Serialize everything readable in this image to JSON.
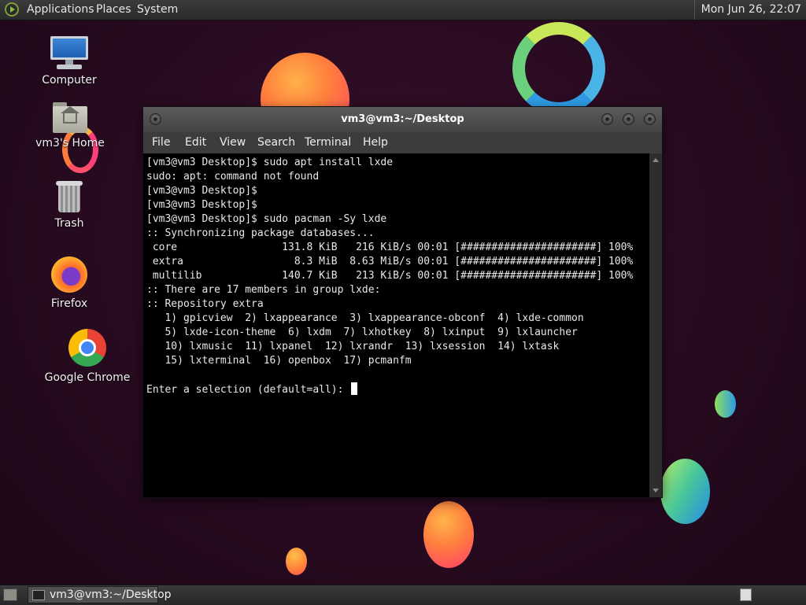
{
  "top_panel": {
    "menus": [
      "Applications",
      "Places",
      "System"
    ],
    "clock": "Mon Jun 26, 22:07"
  },
  "desktop": {
    "icons": [
      {
        "label": "Computer",
        "icon": "computer-icon"
      },
      {
        "label": "vm3's Home",
        "icon": "home-folder-icon"
      },
      {
        "label": "Trash",
        "icon": "trash-icon"
      },
      {
        "label": "Firefox",
        "icon": "firefox-icon"
      },
      {
        "label": "Google Chrome",
        "icon": "chrome-icon"
      }
    ]
  },
  "window": {
    "title": "vm3@vm3:~/Desktop",
    "menu": [
      "File",
      "Edit",
      "View",
      "Search",
      "Terminal",
      "Help"
    ],
    "terminal_lines": [
      "[vm3@vm3 Desktop]$ sudo apt install lxde",
      "sudo: apt: command not found",
      "[vm3@vm3 Desktop]$",
      "[vm3@vm3 Desktop]$",
      "[vm3@vm3 Desktop]$ sudo pacman -Sy lxde",
      ":: Synchronizing package databases...",
      " core                 131.8 KiB   216 KiB/s 00:01 [######################] 100%",
      " extra                  8.3 MiB  8.63 MiB/s 00:01 [######################] 100%",
      " multilib             140.7 KiB   213 KiB/s 00:01 [######################] 100%",
      ":: There are 17 members in group lxde:",
      ":: Repository extra",
      "   1) gpicview  2) lxappearance  3) lxappearance-obconf  4) lxde-common",
      "   5) lxde-icon-theme  6) lxdm  7) lxhotkey  8) lxinput  9) lxlauncher",
      "   10) lxmusic  11) lxpanel  12) lxrandr  13) lxsession  14) lxtask",
      "   15) lxterminal  16) openbox  17) pcmanfm",
      ""
    ],
    "prompt": "Enter a selection (default=all): "
  },
  "taskbar": {
    "task_label": "vm3@vm3:~/Desktop"
  }
}
